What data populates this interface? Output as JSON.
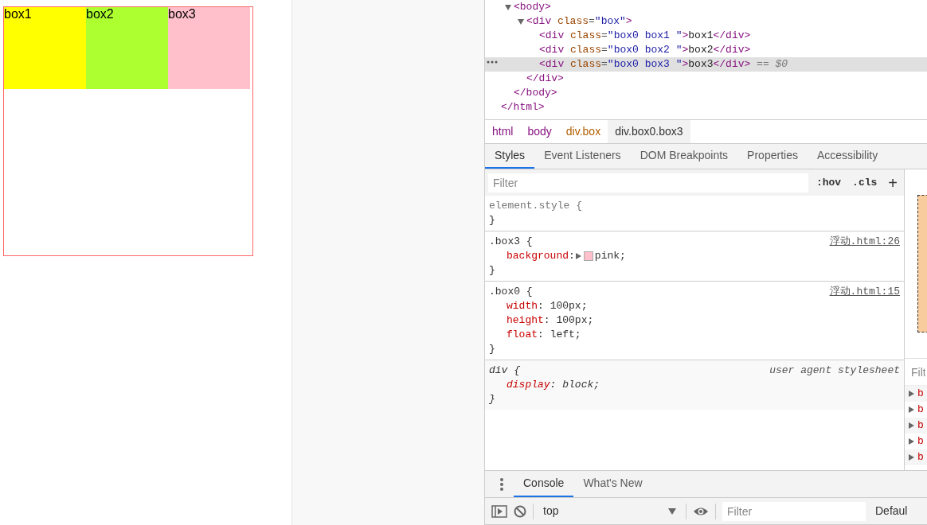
{
  "page_boxes": [
    {
      "label": "box1",
      "color": "#ffff00"
    },
    {
      "label": "box2",
      "color": "#adff2f"
    },
    {
      "label": "box3",
      "color": "#ffc0cb"
    }
  ],
  "dom_tree": [
    {
      "close": [
        {
          "kind": "tag",
          "s": "</html>"
        }
      ],
      "children": [
        {
          "expanded": true,
          "open": [
            {
              "kind": "tag",
              "s": "<body>"
            }
          ],
          "close": [
            {
              "kind": "tag",
              "s": "</body>"
            }
          ],
          "children": [
            {
              "expanded": true,
              "open": [
                {
                  "kind": "tag",
                  "s": "<div"
                },
                {
                  "kind": "attr",
                  "s": " class"
                },
                {
                  "kind": "punct",
                  "s": "="
                },
                {
                  "kind": "value",
                  "s": "\"box\""
                },
                {
                  "kind": "tag",
                  "s": ">"
                }
              ],
              "close": [
                {
                  "kind": "tag",
                  "s": "</div>"
                }
              ],
              "children": [
                {
                  "selected": false,
                  "open": [
                    {
                      "kind": "tag",
                      "s": "<div"
                    },
                    {
                      "kind": "attr",
                      "s": " class"
                    },
                    {
                      "kind": "punct",
                      "s": "="
                    },
                    {
                      "kind": "value",
                      "s": "\"box0 box1 \""
                    },
                    {
                      "kind": "tag",
                      "s": ">"
                    },
                    {
                      "kind": "text",
                      "s": "box1"
                    },
                    {
                      "kind": "tag",
                      "s": "</div>"
                    }
                  ]
                },
                {
                  "selected": false,
                  "open": [
                    {
                      "kind": "tag",
                      "s": "<div"
                    },
                    {
                      "kind": "attr",
                      "s": " class"
                    },
                    {
                      "kind": "punct",
                      "s": "="
                    },
                    {
                      "kind": "value",
                      "s": "\"box0 box2 \""
                    },
                    {
                      "kind": "tag",
                      "s": ">"
                    },
                    {
                      "kind": "text",
                      "s": "box2"
                    },
                    {
                      "kind": "tag",
                      "s": "</div>"
                    }
                  ]
                },
                {
                  "selected": true,
                  "open": [
                    {
                      "kind": "tag",
                      "s": "<div"
                    },
                    {
                      "kind": "attr",
                      "s": " class"
                    },
                    {
                      "kind": "punct",
                      "s": "="
                    },
                    {
                      "kind": "value",
                      "s": "\"box0 box3 \""
                    },
                    {
                      "kind": "tag",
                      "s": ">"
                    },
                    {
                      "kind": "text",
                      "s": "box3"
                    },
                    {
                      "kind": "tag",
                      "s": "</div>"
                    },
                    {
                      "kind": "marker",
                      "s": " == $0"
                    }
                  ]
                }
              ]
            }
          ]
        }
      ]
    }
  ],
  "breadcrumb": [
    {
      "label": "html",
      "kind": "tag",
      "selected": false
    },
    {
      "label": "body",
      "kind": "tag",
      "selected": false
    },
    {
      "label": "div.box",
      "kind": "element",
      "selected": false
    },
    {
      "label": "div.box0.box3",
      "kind": "element",
      "selected": true
    }
  ],
  "tabs": [
    {
      "label": "Styles",
      "selected": true
    },
    {
      "label": "Event Listeners",
      "selected": false
    },
    {
      "label": "DOM Breakpoints",
      "selected": false
    },
    {
      "label": "Properties",
      "selected": false
    },
    {
      "label": "Accessibility",
      "selected": false
    }
  ],
  "styles_toolbar": {
    "placeholder": "Filter",
    "buttons": [
      ":hov",
      ".cls",
      "+"
    ]
  },
  "rules": [
    {
      "kind": "inline",
      "selector": "element.style {",
      "close": "}"
    },
    {
      "kind": "author",
      "selector": ".box3 {",
      "source": "浮动.html:26",
      "close": "}",
      "declarations": [
        {
          "prop": "background",
          "sep": ":",
          "value": "pink;",
          "color": "#ffc0cb"
        }
      ]
    },
    {
      "kind": "author",
      "selector": ".box0 {",
      "source": "浮动.html:15",
      "close": "}",
      "declarations": [
        {
          "prop": "width",
          "sep": ":",
          "value": " 100px;"
        },
        {
          "prop": "height",
          "sep": ":",
          "value": " 100px;"
        },
        {
          "prop": "float",
          "sep": ":",
          "value": " left;"
        }
      ]
    },
    {
      "kind": "user-agent",
      "selector": "div {",
      "source": "user agent stylesheet",
      "close": "}",
      "declarations": [
        {
          "prop": "display",
          "sep": ":",
          "value": " block;"
        }
      ]
    }
  ],
  "side_pane": {
    "filter_placeholder": "Filt",
    "properties": [
      "b",
      "b",
      "b",
      "b",
      "b"
    ]
  },
  "drawer": {
    "tabs": [
      {
        "label": "Console",
        "selected": true
      },
      {
        "label": "What's New",
        "selected": false
      }
    ],
    "context": "top",
    "filter_placeholder": "Filter",
    "levels": "Defaul"
  }
}
